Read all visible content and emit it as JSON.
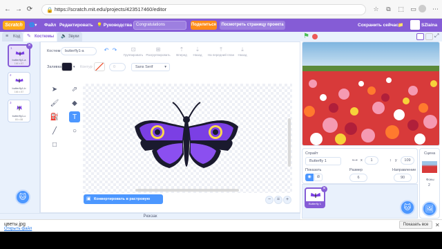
{
  "browser": {
    "url": "https://scratch.mit.edu/projects/423517460/editor"
  },
  "menu": {
    "logo": "Scratch",
    "file": "Файл",
    "edit": "Редактировать",
    "tutorials": "Руководства",
    "project_title": "Congratulations",
    "share": "Поделиться",
    "see_project": "Посмотреть страницу проекта",
    "save_now": "Сохранить сейчас",
    "user": "SZlaina"
  },
  "tabs": {
    "code": "Код",
    "costumes": "Костюмы",
    "sounds": "Звуки"
  },
  "costumes": [
    {
      "num": "1",
      "name": "butterfly1-a",
      "size": "166 x 87"
    },
    {
      "num": "2",
      "name": "butterfly1-b",
      "size": "166 x 87"
    },
    {
      "num": "3",
      "name": "butterfly1-c",
      "size": "65 x 88"
    }
  ],
  "paint": {
    "costume_label": "Костюм",
    "costume_name": "butterfly1-a",
    "group": "Группировать",
    "ungroup": "Разгруппировать",
    "forward": "Вперед",
    "backward": "Назад",
    "front": "На передний план",
    "back": "Назад",
    "fill_label": "Заливка",
    "outline_label": "Контур",
    "outline_value": "0",
    "font": "Sans Serif",
    "convert": "Конвертировать в растровую графику",
    "zoom_out": "−",
    "zoom_reset": "=",
    "zoom_in": "+"
  },
  "backpack": "Рюкзак",
  "sprite_info": {
    "sprite_label": "Спрайт",
    "sprite_name": "Butterfly 1",
    "x_label": "x",
    "x_value": "1",
    "y_label": "y",
    "y_value": "109",
    "show_label": "Показать",
    "size_label": "Размер",
    "size_value": "6",
    "direction_label": "Направление",
    "direction_value": "90"
  },
  "sprite_thumb": "Butterfly 1",
  "stage_panel": {
    "label": "Сцена",
    "backdrops_label": "Фоны",
    "backdrops_count": "2"
  },
  "download": {
    "filename": "цветы.jpg",
    "open_file": "Открыть файл",
    "show_all": "Показать все"
  },
  "colors": {
    "scratch_purple": "#855cd6",
    "scratch_blue": "#4c97ff",
    "orange": "#ff8c1a",
    "fill_color": "#1a1a2e"
  }
}
